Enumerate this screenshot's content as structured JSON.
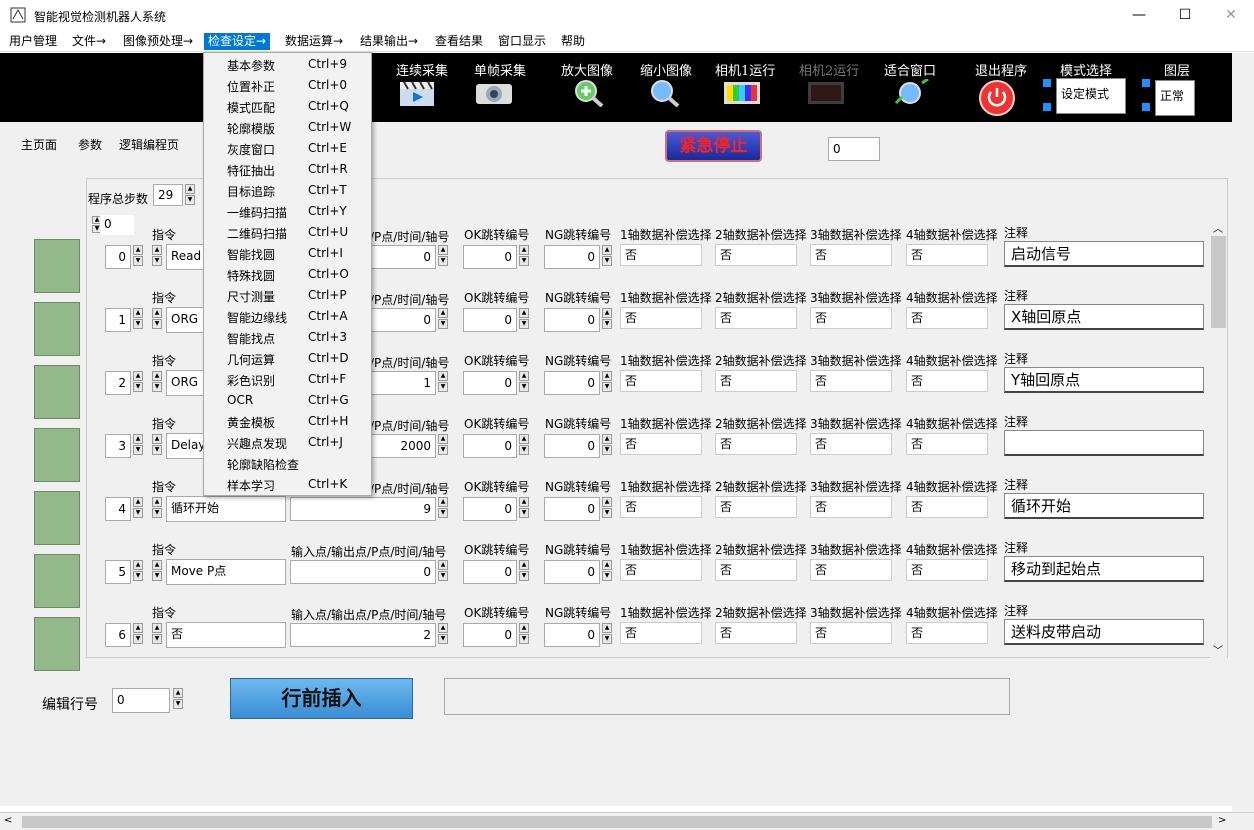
{
  "window": {
    "title": "智能视觉检测机器人系统",
    "minimize": "—",
    "maximize": "☐",
    "close": "✕"
  },
  "menu": [
    "用户管理",
    "文件→",
    "图像预处理→",
    "检查设定→",
    "数据运算→",
    "结果输出→",
    "查看结果",
    "窗口显示",
    "帮助"
  ],
  "toolbar": {
    "buttons": [
      {
        "label": "连续采集",
        "icon": "clapper-icon"
      },
      {
        "label": "单帧采集",
        "icon": "camera-icon"
      },
      {
        "label": "放大图像",
        "icon": "zoom-in-icon"
      },
      {
        "label": "缩小图像",
        "icon": "zoom-out-icon"
      },
      {
        "label": "相机1运行",
        "icon": "tv-icon"
      },
      {
        "label": "相机2运行",
        "icon": "tv-icon",
        "disabled": true
      },
      {
        "label": "适合窗口",
        "icon": "fit-window-icon"
      },
      {
        "label": "退出程序",
        "icon": "power-icon"
      }
    ],
    "mode_label": "模式选择",
    "mode_value": "设定模式",
    "layer_label": "图层",
    "layer_value": "正常"
  },
  "tabs": [
    "主页面",
    "参数",
    "逻辑编程页"
  ],
  "emergency_stop": "紧急停止",
  "counter_value": "0",
  "total_steps_label": "程序总步数",
  "total_steps_value": "29",
  "top_spin_value": "0",
  "headers": {
    "instr": "指令",
    "io": "输入点/输出点/P点/时间/轴号",
    "io_short": "/P点/时间/轴号",
    "ok": "OK跳转编号",
    "ng": "NG跳转编号",
    "c1": "1轴数据补偿选择",
    "c2": "2轴数据补偿选择",
    "c3": "3轴数据补偿选择",
    "c4": "4轴数据补偿选择",
    "note": "注释"
  },
  "rows": [
    {
      "idx": "0",
      "instr": "Read",
      "io": "0",
      "ok": "0",
      "ng": "0",
      "c": [
        "否",
        "否",
        "否",
        "否"
      ],
      "note": "启动信号"
    },
    {
      "idx": "1",
      "instr": "ORG",
      "io": "0",
      "ok": "0",
      "ng": "0",
      "c": [
        "否",
        "否",
        "否",
        "否"
      ],
      "note": "X轴回原点"
    },
    {
      "idx": "2",
      "instr": "ORG",
      "io": "1",
      "ok": "0",
      "ng": "0",
      "c": [
        "否",
        "否",
        "否",
        "否"
      ],
      "note": "Y轴回原点"
    },
    {
      "idx": "3",
      "instr": "Delay",
      "io": "2000",
      "ok": "0",
      "ng": "0",
      "c": [
        "否",
        "否",
        "否",
        "否"
      ],
      "note": ""
    },
    {
      "idx": "4",
      "instr": "循环开始",
      "io": "9",
      "ok": "0",
      "ng": "0",
      "c": [
        "否",
        "否",
        "否",
        "否"
      ],
      "note": "循环开始"
    },
    {
      "idx": "5",
      "instr": "Move P点",
      "io": "0",
      "ok": "0",
      "ng": "0",
      "c": [
        "否",
        "否",
        "否",
        "否"
      ],
      "note": "移动到起始点"
    },
    {
      "idx": "6",
      "instr": "否",
      "io": "2",
      "ok": "0",
      "ng": "0",
      "c": [
        "否",
        "否",
        "否",
        "否"
      ],
      "note": "送料皮带启动"
    }
  ],
  "edit_row_label": "编辑行号",
  "edit_row_value": "0",
  "insert_button": "行前插入",
  "dropdown": [
    {
      "label": "基本参数",
      "shortcut": "Ctrl+9"
    },
    {
      "label": "位置补正",
      "shortcut": "Ctrl+0"
    },
    {
      "label": "模式匹配",
      "shortcut": "Ctrl+Q"
    },
    {
      "label": "轮廓模版",
      "shortcut": "Ctrl+W"
    },
    {
      "label": "灰度窗口",
      "shortcut": "Ctrl+E"
    },
    {
      "label": "特征抽出",
      "shortcut": "Ctrl+R"
    },
    {
      "label": "目标追踪",
      "shortcut": "Ctrl+T"
    },
    {
      "label": "一维码扫描",
      "shortcut": "Ctrl+Y"
    },
    {
      "label": "二维码扫描",
      "shortcut": "Ctrl+U"
    },
    {
      "label": "智能找圆",
      "shortcut": "Ctrl+I"
    },
    {
      "label": "特殊找圆",
      "shortcut": "Ctrl+O"
    },
    {
      "label": "尺寸测量",
      "shortcut": "Ctrl+P"
    },
    {
      "label": "智能边缘线",
      "shortcut": "Ctrl+A"
    },
    {
      "label": "智能找点",
      "shortcut": "Ctrl+3"
    },
    {
      "label": "几何运算",
      "shortcut": "Ctrl+D"
    },
    {
      "label": "彩色识别",
      "shortcut": "Ctrl+F"
    },
    {
      "label": "OCR",
      "shortcut": "Ctrl+G"
    },
    {
      "label": "黄金模板",
      "shortcut": "Ctrl+H"
    },
    {
      "label": "兴趣点发现",
      "shortcut": "Ctrl+J"
    },
    {
      "label": "轮廓缺陷检查",
      "shortcut": ""
    },
    {
      "label": "样本学习",
      "shortcut": "Ctrl+K"
    }
  ]
}
